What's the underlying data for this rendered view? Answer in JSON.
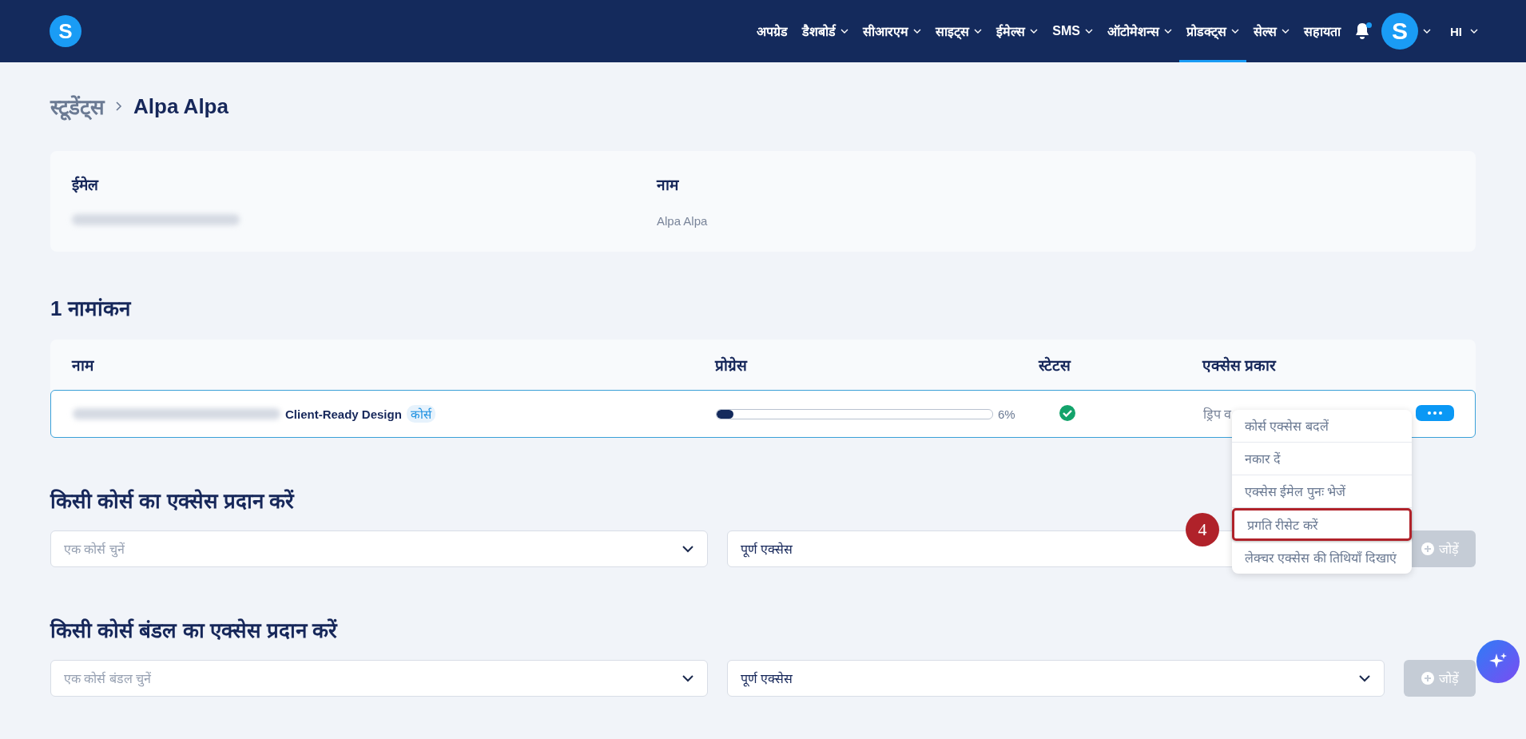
{
  "nav": {
    "logo": "S",
    "items": [
      {
        "label": "अपग्रेड",
        "dropdown": false,
        "selected": false
      },
      {
        "label": "डैशबोर्ड",
        "dropdown": true,
        "selected": false
      },
      {
        "label": "सीआरएम",
        "dropdown": true,
        "selected": false
      },
      {
        "label": "साइट्स",
        "dropdown": true,
        "selected": false
      },
      {
        "label": "ईमेल्स",
        "dropdown": true,
        "selected": false
      },
      {
        "label": "SMS",
        "dropdown": true,
        "selected": false
      },
      {
        "label": "ऑटोमेशन्स",
        "dropdown": true,
        "selected": false
      },
      {
        "label": "प्रोडक्ट्स",
        "dropdown": true,
        "selected": true
      },
      {
        "label": "सेल्स",
        "dropdown": true,
        "selected": false
      },
      {
        "label": "सहायता",
        "dropdown": false,
        "selected": false
      }
    ],
    "notification_dot": true,
    "avatar": "S",
    "language": "HI"
  },
  "breadcrumb": {
    "parent": "स्टूडेंट्स",
    "current": "Alpa Alpa"
  },
  "student": {
    "email_label": "ईमेल",
    "name_label": "नाम",
    "name": "Alpa Alpa"
  },
  "enrollments": {
    "title": "1 नामांकन",
    "columns": [
      "नाम",
      "प्रोग्रेस",
      "स्टेटस",
      "एक्सेस प्रकार"
    ],
    "rows": [
      {
        "course_name": "Client-Ready Design",
        "tag": "कोर्स",
        "level": 0.06,
        "progress": "6%",
        "active": true,
        "access": "ड्रिप व"
      }
    ]
  },
  "menu": {
    "items": [
      {
        "label": "कोर्स एक्सेस बदलें",
        "highlighted": false
      },
      {
        "label": "नकार दें",
        "highlighted": false
      },
      {
        "label": "एक्सेस ईमेल पुनः भेजें",
        "highlighted": false
      },
      {
        "label": "प्रगति रीसेट करें",
        "highlighted": true
      },
      {
        "label": "लेक्चर एक्सेस की तिथियाँ दिखाएं",
        "highlighted": false
      }
    ],
    "step_badge": "4"
  },
  "grant_sections": [
    {
      "title": "किसी कोर्स का एक्सेस प्रदान करें",
      "placeholder": "एक कोर्स चुनें",
      "access": "पूर्ण एक्सेस",
      "button": "जोड़ें",
      "disabled": true
    },
    {
      "title": "किसी कोर्स बंडल का एक्सेस प्रदान करें",
      "placeholder": "एक कोर्स बंडल चुनें",
      "access": "पूर्ण एक्सेस",
      "button": "जोड़ें",
      "disabled": true
    }
  ]
}
